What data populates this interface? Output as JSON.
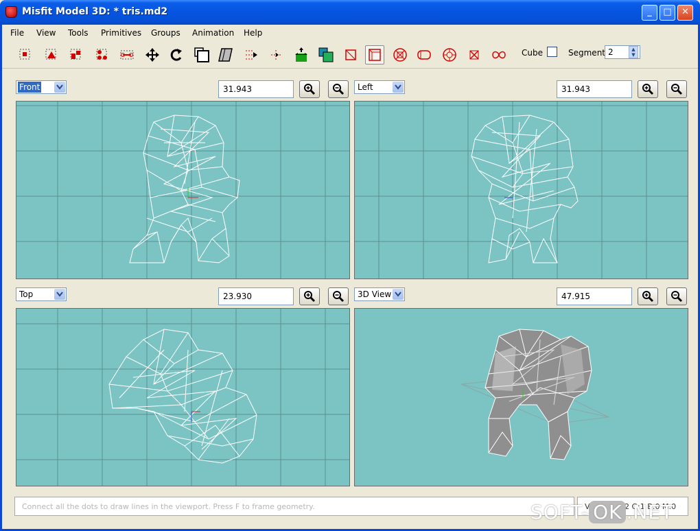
{
  "window": {
    "title": "Misfit Model 3D: * tris.md2",
    "minimize": "_",
    "maximize": "□",
    "close": "✕"
  },
  "menu": [
    "File",
    "View",
    "Tools",
    "Primitives",
    "Groups",
    "Animation",
    "Help"
  ],
  "toolbar": {
    "cube_label": "Cube",
    "segment_label": "Segment",
    "segment_value": "2"
  },
  "views": [
    {
      "mode": "Front",
      "zoom": "31.943",
      "highlighted": true
    },
    {
      "mode": "Left",
      "zoom": "31.943",
      "highlighted": false
    },
    {
      "mode": "Top",
      "zoom": "23.930",
      "highlighted": false
    },
    {
      "mode": "3D View",
      "zoom": "47.915",
      "highlighted": false
    }
  ],
  "status": {
    "message": "Connect all the dots to draw lines in the viewport. Press F to frame geometry.",
    "counts": "V:269 F:532 G:1 B:0 M:0"
  },
  "watermark": {
    "left": "SOFT-",
    "mid": "OK",
    "right": ".NET"
  },
  "colors": {
    "viewport_bg": "#7cc4c4",
    "grid": "#5a8f8f",
    "wire": "#ffffff",
    "title_bar": "#0654e0"
  }
}
